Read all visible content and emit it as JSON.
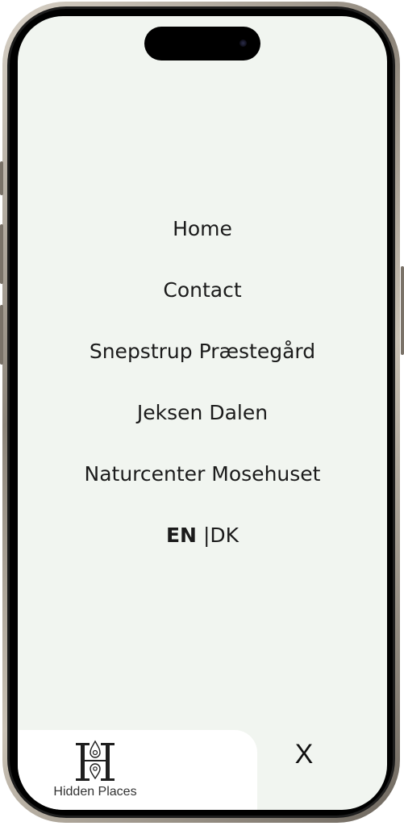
{
  "menu": {
    "items": [
      {
        "label": "Home"
      },
      {
        "label": "Contact"
      },
      {
        "label": "Snepstrup Præstegård"
      },
      {
        "label": "Jeksen Dalen"
      },
      {
        "label": "Naturcenter Mosehuset"
      }
    ],
    "language": {
      "active": "EN",
      "separator": "|",
      "other": "DK"
    }
  },
  "brand": {
    "name": "Hidden Places",
    "logo_icon": "h-location-pin-logo-icon"
  },
  "close_label": "X",
  "colors": {
    "screen_background": "#f1f5f0",
    "card_background": "#ffffff",
    "text": "#1b1b1b"
  }
}
